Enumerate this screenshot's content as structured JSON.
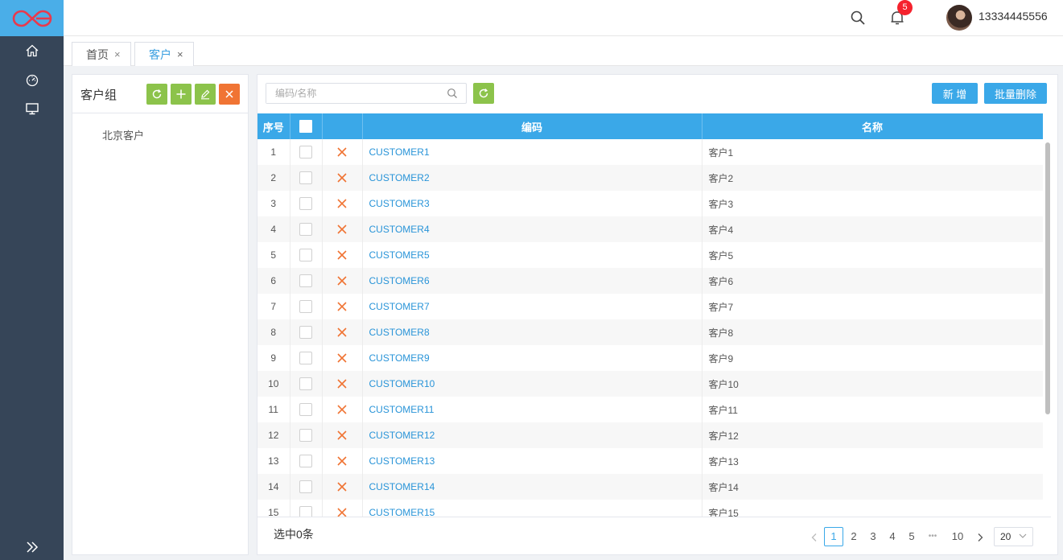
{
  "header": {
    "notifications_count": "5",
    "username": "13334445556"
  },
  "tabs": [
    {
      "label": "首页",
      "close": "×"
    },
    {
      "label": "客户",
      "close": "×"
    }
  ],
  "left_panel": {
    "title": "客户组",
    "tree_items": [
      "北京客户"
    ]
  },
  "toolbar": {
    "search_placeholder": "编码/名称",
    "add_label": "新 增",
    "batch_delete_label": "批量删除"
  },
  "table": {
    "headers": {
      "index": "序号",
      "code": "编码",
      "name": "名称"
    },
    "rows": [
      {
        "index": "1",
        "code": "CUSTOMER1",
        "name": "客户1"
      },
      {
        "index": "2",
        "code": "CUSTOMER2",
        "name": "客户2"
      },
      {
        "index": "3",
        "code": "CUSTOMER3",
        "name": "客户3"
      },
      {
        "index": "4",
        "code": "CUSTOMER4",
        "name": "客户4"
      },
      {
        "index": "5",
        "code": "CUSTOMER5",
        "name": "客户5"
      },
      {
        "index": "6",
        "code": "CUSTOMER6",
        "name": "客户6"
      },
      {
        "index": "7",
        "code": "CUSTOMER7",
        "name": "客户7"
      },
      {
        "index": "8",
        "code": "CUSTOMER8",
        "name": "客户8"
      },
      {
        "index": "9",
        "code": "CUSTOMER9",
        "name": "客户9"
      },
      {
        "index": "10",
        "code": "CUSTOMER10",
        "name": "客户10"
      },
      {
        "index": "11",
        "code": "CUSTOMER11",
        "name": "客户11"
      },
      {
        "index": "12",
        "code": "CUSTOMER12",
        "name": "客户12"
      },
      {
        "index": "13",
        "code": "CUSTOMER13",
        "name": "客户13"
      },
      {
        "index": "14",
        "code": "CUSTOMER14",
        "name": "客户14"
      },
      {
        "index": "15",
        "code": "CUSTOMER15",
        "name": "客户15"
      }
    ]
  },
  "footer": {
    "selected_text": "选中0条",
    "pages": [
      "1",
      "2",
      "3",
      "4",
      "5"
    ],
    "ellipsis": "•••",
    "last_page": "10",
    "current_page": "1",
    "page_size": "20"
  },
  "colors": {
    "sidebar": "#364558",
    "accent": "#3aa8e8",
    "green_button": "#8cc34b",
    "orange_button": "#f07434",
    "delete_icon": "#f07434"
  },
  "icons": {
    "logo": "logo-mark",
    "sidebar": [
      "home-icon",
      "dashboard-icon",
      "monitor-icon"
    ],
    "expand": "double-chevron-right-icon",
    "header": [
      "search-icon",
      "bell-icon"
    ]
  }
}
